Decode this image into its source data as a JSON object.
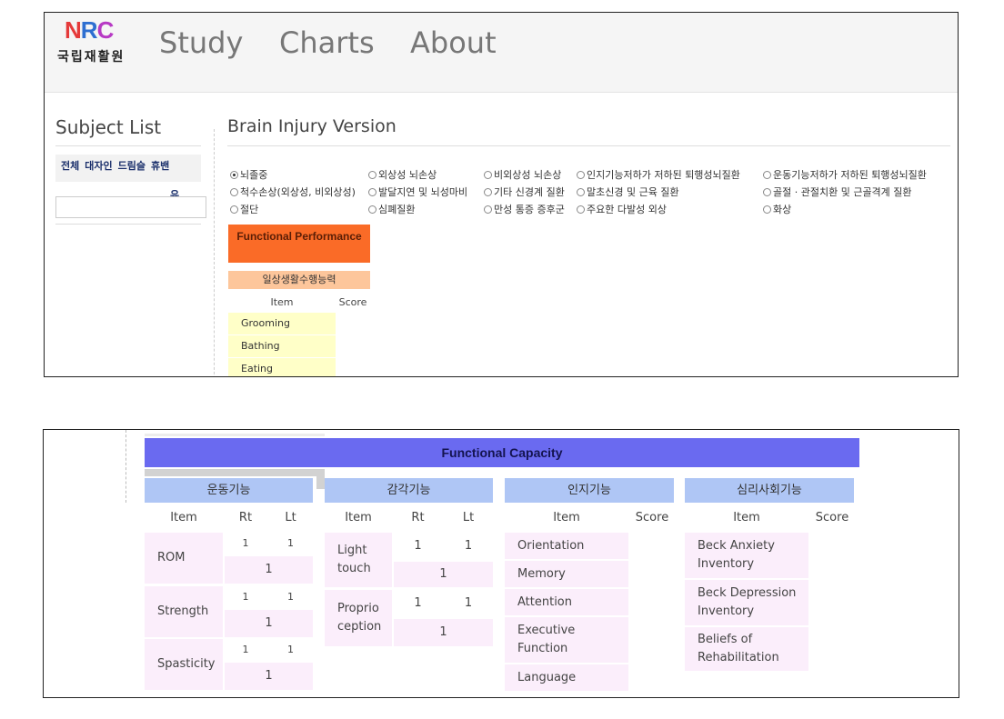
{
  "header": {
    "logo_mark": "NRC",
    "logo_text": "국립재활원",
    "nav": [
      "Study",
      "Charts",
      "About"
    ]
  },
  "sidebar": {
    "title": "Subject List",
    "filters": [
      "전체",
      "대자인",
      "드림슬",
      "휴밴"
    ],
    "filter_overflow": "유",
    "search_value": ""
  },
  "main": {
    "title": "Brain Injury Version",
    "radio_options": [
      {
        "label": "뇌졸중",
        "checked": true
      },
      {
        "label": "외상성 뇌손상",
        "checked": false
      },
      {
        "label": "비외상성 뇌손상",
        "checked": false
      },
      {
        "label": "인지기능저하가 저하된 퇴행성뇌질환",
        "checked": false
      },
      {
        "label": "운동기능저하가 저하된 퇴행성뇌질환",
        "checked": false
      },
      {
        "label": "척수손상(외상성, 비외상성)",
        "checked": false
      },
      {
        "label": "발달지연 및 뇌성마비",
        "checked": false
      },
      {
        "label": "기타 신경계 질환",
        "checked": false
      },
      {
        "label": "말초신경 및 근육 질환",
        "checked": false
      },
      {
        "label": "골절 · 관절치환 및 근골격계 질환",
        "checked": false
      },
      {
        "label": "절단",
        "checked": false
      },
      {
        "label": "심폐질환",
        "checked": false
      },
      {
        "label": "만성 통증 증후군",
        "checked": false
      },
      {
        "label": "주요한 다발성 외상",
        "checked": false
      },
      {
        "label": "화상",
        "checked": false
      }
    ],
    "functional_performance": {
      "title": "Functional Performance",
      "subtitle": "일상생활수행능력",
      "columns": [
        "Item",
        "Score"
      ],
      "items": [
        "Grooming",
        "Bathing",
        "Eating"
      ]
    }
  },
  "functional_capacity": {
    "title": "Functional Capacity",
    "motor": {
      "title": "운동기능",
      "columns": [
        "Item",
        "Rt",
        "Lt"
      ],
      "rows": [
        {
          "item": "ROM",
          "rt": "1",
          "lt": "1",
          "total": "1"
        },
        {
          "item": "Strength",
          "rt": "1",
          "lt": "1",
          "total": "1"
        },
        {
          "item": "Spasticity",
          "rt": "1",
          "lt": "1",
          "total": "1"
        }
      ]
    },
    "sensory": {
      "title": "감각기능",
      "columns": [
        "Item",
        "Rt",
        "Lt"
      ],
      "rows": [
        {
          "item": "Light touch",
          "rt": "1",
          "lt": "1",
          "total": "1"
        },
        {
          "item": "Proprio ception",
          "rt": "1",
          "lt": "1",
          "total": "1"
        }
      ]
    },
    "cognitive": {
      "title": "인지기능",
      "columns": [
        "Item",
        "Score"
      ],
      "items": [
        "Orientation",
        "Memory",
        "Attention",
        "Executive Function",
        "Language"
      ]
    },
    "psychosocial": {
      "title": "심리사회기능",
      "columns": [
        "Item",
        "Score"
      ],
      "items": [
        "Beck Anxiety Inventory",
        "Beck Depression Inventory",
        "Beliefs of Rehabilitation"
      ]
    }
  }
}
